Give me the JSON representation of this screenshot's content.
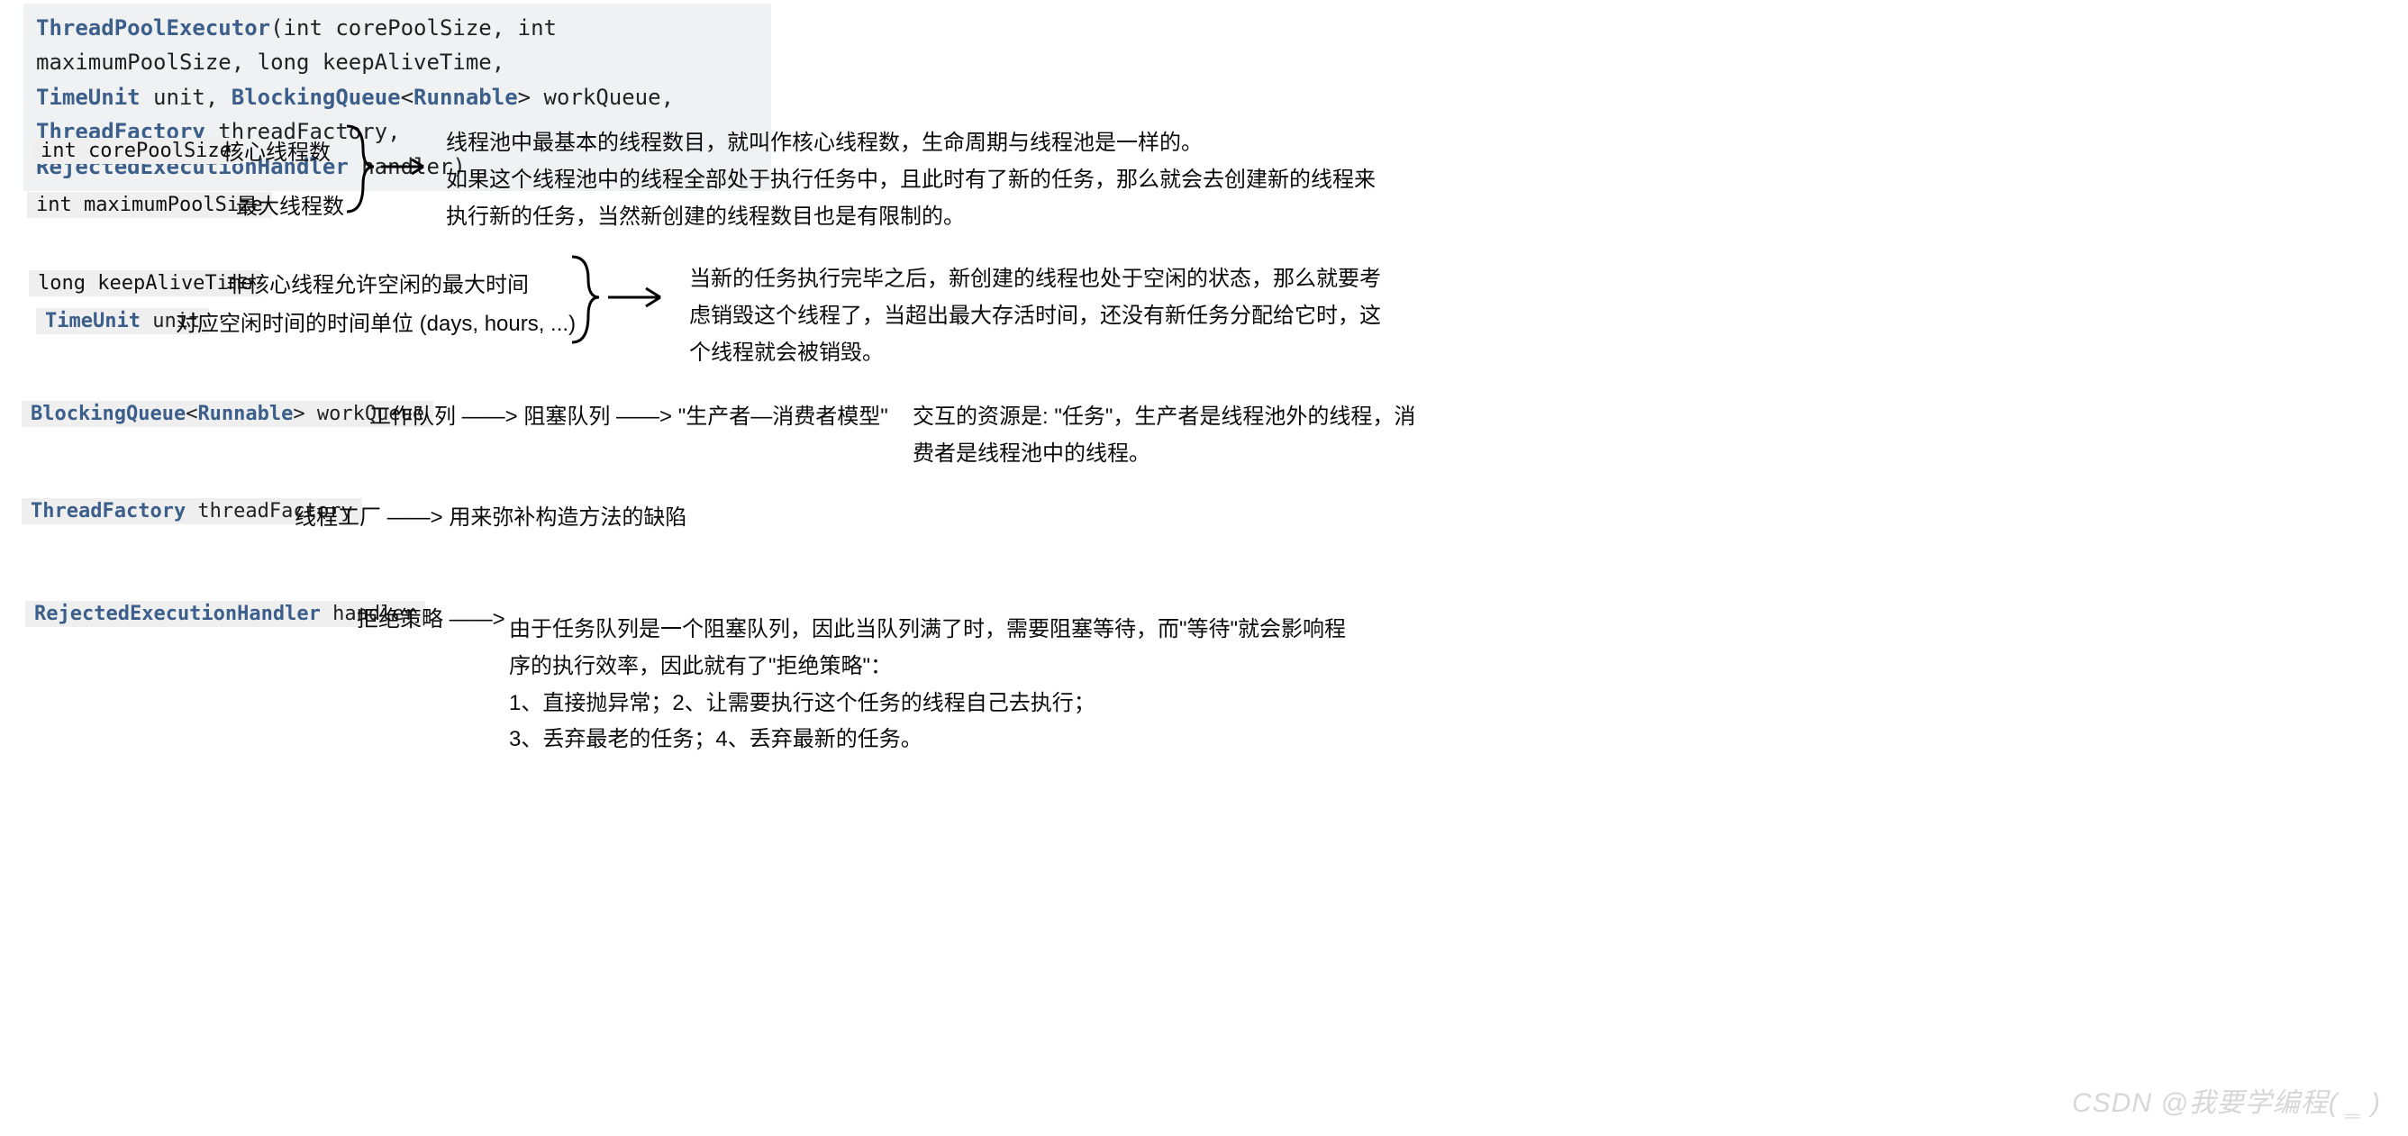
{
  "signature": {
    "tokens": [
      {
        "t": "ThreadPoolExecutor",
        "k": true
      },
      {
        "t": "(",
        "k": false
      },
      {
        "t": "int",
        "k": false
      },
      {
        "t": " corePoolSize, ",
        "k": false
      },
      {
        "t": "int",
        "k": false
      },
      {
        "t": " maximumPoolSize, ",
        "k": false
      },
      {
        "t": "long",
        "k": false
      },
      {
        "t": " keepAliveTime,",
        "k": false
      },
      {
        "t": "\n",
        "k": false
      },
      {
        "t": "TimeUnit",
        "k": true
      },
      {
        "t": " unit, ",
        "k": false
      },
      {
        "t": "BlockingQueue",
        "k": true
      },
      {
        "t": "<",
        "k": false
      },
      {
        "t": "Runnable",
        "k": true
      },
      {
        "t": "> workQueue, ",
        "k": false
      },
      {
        "t": "ThreadFactory",
        "k": true
      },
      {
        "t": " threadFactory,",
        "k": false
      },
      {
        "t": "\n",
        "k": false
      },
      {
        "t": "RejectedExecutionHandler",
        "k": true
      },
      {
        "t": " handler)",
        "k": false
      }
    ]
  },
  "param_core": {
    "code": "int corePoolSize",
    "label": "核心线程数"
  },
  "param_max": {
    "code": "int maximumPoolSize",
    "label": "最大线程数"
  },
  "explain_core_max": "线程池中最基本的线程数目，就叫作核心线程数，生命周期与线程池是一样的。\n如果这个线程池中的线程全部处于执行任务中，且此时有了新的任务，那么就会去创建新的线程来执行新的任务，当然新创建的线程数目也是有限制的。",
  "param_keep": {
    "code": "long keepAliveTime",
    "label": "非核心线程允许空闲的最大时间"
  },
  "param_unit": {
    "code_tokens": [
      {
        "t": "TimeUnit",
        "k": true
      },
      {
        "t": " unit",
        "k": false
      }
    ],
    "label": "对应空闲时间的时间单位 (days, hours, ...)"
  },
  "explain_keep": "当新的任务执行完毕之后，新创建的线程也处于空闲的状态，那么就要考虑销毁这个线程了，当超出最大存活时间，还没有新任务分配给它时，这个线程就会被销毁。",
  "param_queue": {
    "code_tokens": [
      {
        "t": "BlockingQueue",
        "k": true
      },
      {
        "t": "<",
        "k": false
      },
      {
        "t": "Runnable",
        "k": true
      },
      {
        "t": "> workQueue",
        "k": false
      }
    ],
    "flow": "工作队列 ——> 阻塞队列 ——> \"生产者—消费者模型\""
  },
  "explain_queue": "交互的资源是: \"任务\"，生产者是线程池外的线程，消费者是线程池中的线程。",
  "param_factory": {
    "code_tokens": [
      {
        "t": "ThreadFactory",
        "k": true
      },
      {
        "t": " threadFactory",
        "k": false
      }
    ],
    "flow": "线程工厂 ——> 用来弥补构造方法的缺陷"
  },
  "param_handler": {
    "code_tokens": [
      {
        "t": "RejectedExecutionHandler",
        "k": true
      },
      {
        "t": " handler",
        "k": false
      }
    ],
    "label": "拒绝策略 ——>"
  },
  "explain_handler": "由于任务队列是一个阻塞队列，因此当队列满了时，需要阻塞等待，而\"等待\"就会影响程序的执行效率，因此就有了\"拒绝策略\"：\n1、直接抛异常；2、让需要执行这个任务的线程自己去执行；\n3、丢弃最老的任务；4、丢弃最新的任务。",
  "watermark": "CSDN @我要学编程( ‗ )"
}
